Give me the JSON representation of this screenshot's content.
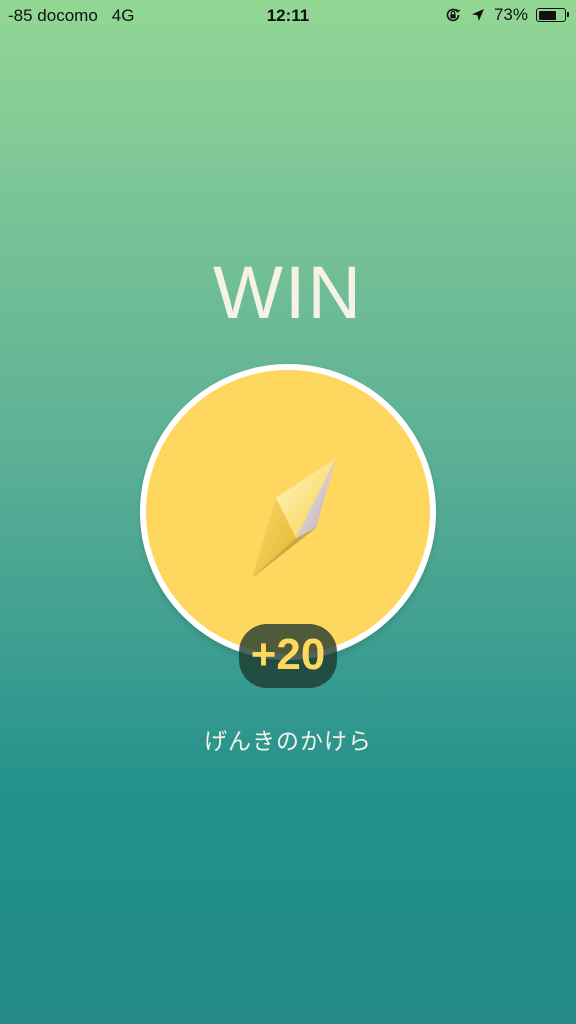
{
  "status_bar": {
    "carrier": "-85 docomo",
    "network": "4G",
    "time": "12:11",
    "battery_percent": "73%",
    "battery_level": 0.73,
    "icons": [
      "rotation-lock-icon",
      "location-arrow-icon",
      "battery-icon"
    ]
  },
  "result": {
    "title": "WIN"
  },
  "reward": {
    "icon": "shard-icon",
    "count": "+20",
    "name": "げんきのかけら"
  },
  "colors": {
    "gradient_top": "#93d794",
    "gradient_bottom": "#238a88",
    "circle_fill": "#ffd75f",
    "count_text": "#ffd95d",
    "light_text": "#f6f2e6"
  }
}
